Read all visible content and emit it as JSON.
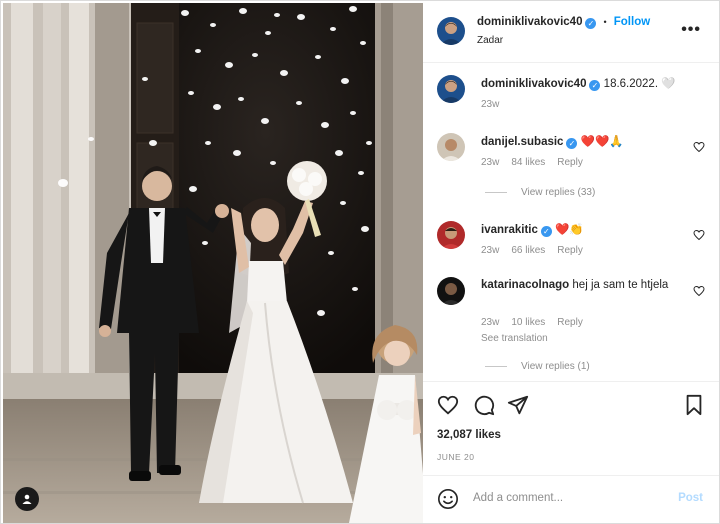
{
  "header": {
    "username": "dominiklivakovic40",
    "follow_label": "Follow",
    "separator": "•",
    "location": "Zadar",
    "more_label": "•••"
  },
  "caption": {
    "username": "dominiklivakovic40",
    "text": "18.6.2022.",
    "emoji": "🤍",
    "time": "23w"
  },
  "comments": [
    {
      "username": "danijel.subasic",
      "verified": true,
      "text": "❤️❤️🙏",
      "time": "23w",
      "likes": "84 likes",
      "reply": "Reply",
      "view_replies": "View replies (33)"
    },
    {
      "username": "ivanrakitic",
      "verified": true,
      "text": "❤️👏",
      "time": "23w",
      "likes": "66 likes",
      "reply": "Reply"
    },
    {
      "username": "katarinacolnago",
      "verified": false,
      "text": "hej ja sam te htjela",
      "time": "23w",
      "likes": "10 likes",
      "reply": "Reply",
      "see_translation": "See translation",
      "view_replies": "View replies (1)"
    }
  ],
  "post": {
    "likes": "32,087 likes",
    "date": "JUNE 20"
  },
  "comment_box": {
    "placeholder": "Add a comment...",
    "post_label": "Post"
  },
  "icons": [
    "heart-icon",
    "comment-icon",
    "share-icon",
    "bookmark-icon",
    "emoji-icon",
    "tag-person-icon",
    "verified-icon",
    "more-icon"
  ],
  "colors": {
    "accent": "#0095f6",
    "verified": "#3897f0",
    "muted": "#8e8e8e",
    "text": "#262626"
  }
}
